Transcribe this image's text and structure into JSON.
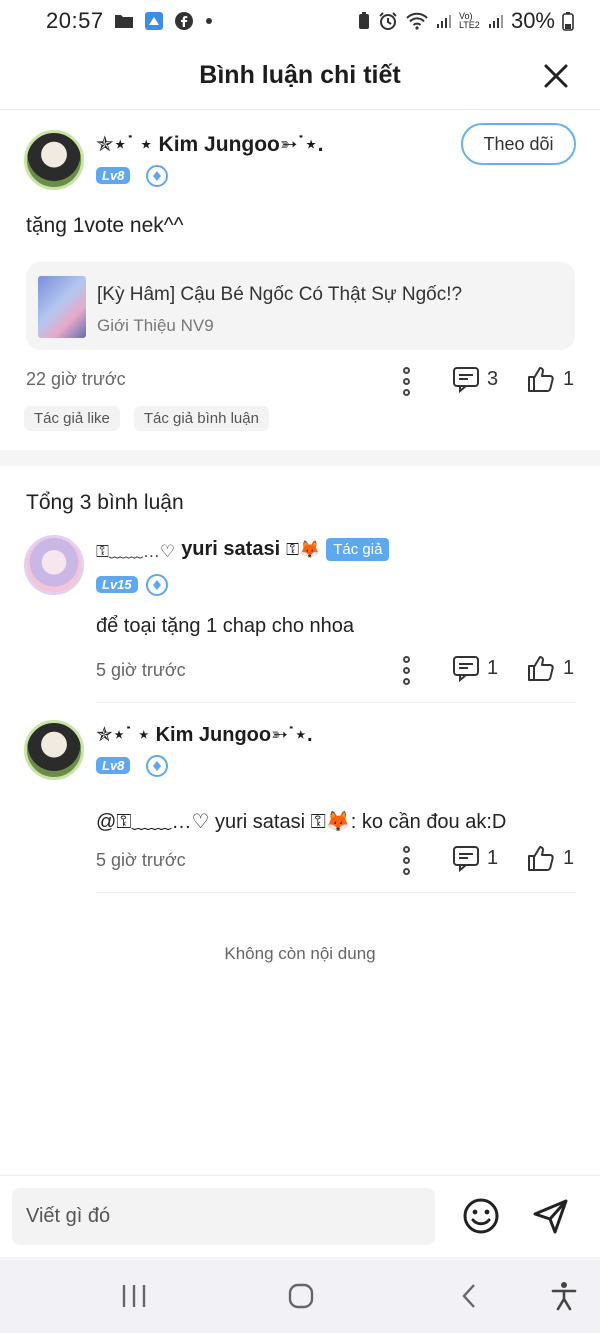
{
  "status_bar": {
    "time": "20:57",
    "network": "Vo) LTE2",
    "battery": "30%"
  },
  "header": {
    "title": "Bình luận chi tiết"
  },
  "post": {
    "username": "✯⋆˙ ⋆ Kim Jungoo➳˙⋆.",
    "level": "Lv8",
    "follow_label": "Theo dõi",
    "content": "tặng 1vote nek^^",
    "novel": {
      "title": "[Kỳ Hâm] Cậu Bé Ngốc Có Thật Sự Ngốc!?",
      "subtitle": "Giới Thiệu NV9"
    },
    "time": "22 giờ trước",
    "comment_count": "3",
    "like_count": "1",
    "chips": [
      "Tác giả like",
      "Tác giả bình luận"
    ]
  },
  "comments_section": {
    "total_label": "Tổng 3 bình luận",
    "comments": [
      {
        "username": "yuri satasi",
        "decor_prefix": "⚿﹏﹏…♡",
        "decor_suffix": "⚿🦊",
        "badge": "Tác giả",
        "level": "Lv15",
        "text": "để toại tặng 1 chap cho nhoa",
        "time": "5 giờ trước",
        "reply_count": "1",
        "like_count": "1"
      },
      {
        "username": "✯⋆˙ ⋆ Kim Jungoo➳˙⋆.",
        "level": "Lv8",
        "text": "@⚿﹏﹏…♡ yuri satasi ⚿🦊: ko cần đou ak:D",
        "time": "5 giờ trước",
        "reply_count": "1",
        "like_count": "1"
      }
    ]
  },
  "footer": {
    "no_more": "Không còn nội dung"
  },
  "input": {
    "placeholder": "Viết gì đó"
  },
  "colors": {
    "accent": "#5ea8ef",
    "follow_border": "#66b3ec",
    "card_bg": "#f4f4f4"
  }
}
